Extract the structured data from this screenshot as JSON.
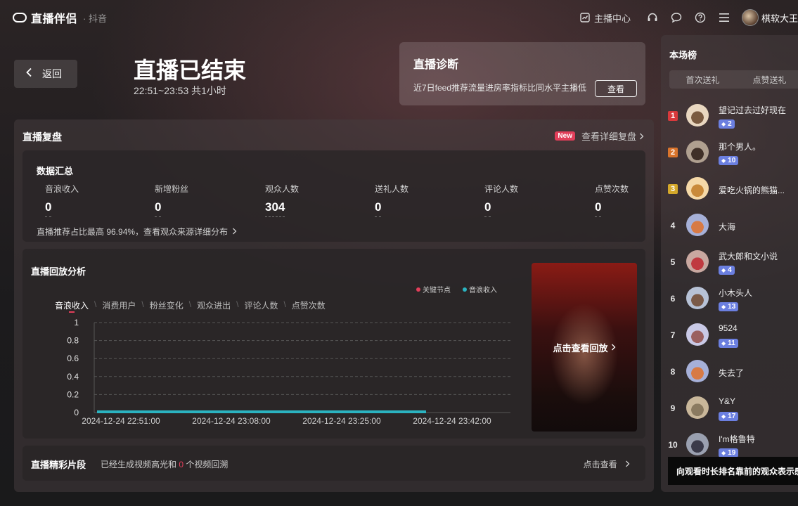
{
  "topbar": {
    "app_name": "直播伴侣",
    "app_sub": "· 抖音",
    "host_center_label": "主播中心",
    "user_name": "棋软大王"
  },
  "header": {
    "back_label": "返回",
    "title": "直播已结束",
    "time_range": "22:51~23:53 共1小时"
  },
  "diagnosis": {
    "title": "直播诊断",
    "desc": "近7日feed推荐流量进房率指标比同水平主播低",
    "button": "查看"
  },
  "review": {
    "title": "直播复盘",
    "badge": "New",
    "link": "查看详细复盘"
  },
  "summary": {
    "title": "数据汇总",
    "metrics": [
      {
        "label": "音浪收入",
        "value": "0"
      },
      {
        "label": "新增粉丝",
        "value": "0"
      },
      {
        "label": "观众人数",
        "value": "304"
      },
      {
        "label": "送礼人数",
        "value": "0"
      },
      {
        "label": "评论人数",
        "value": "0"
      },
      {
        "label": "点赞次数",
        "value": "0"
      }
    ],
    "footnote": "直播推荐占比最高 96.94%，查看观众来源详细分布"
  },
  "replay": {
    "title": "直播回放分析",
    "legend": [
      {
        "label": "关键节点",
        "color": "#e23e5a"
      },
      {
        "label": "音浪收入",
        "color": "#2bb3c0"
      }
    ],
    "tabs": [
      "音浪收入",
      "消费用户",
      "粉丝变化",
      "观众进出",
      "评论人数",
      "点赞次数"
    ],
    "video_label": "点击查看回放"
  },
  "chart_data": {
    "type": "area",
    "series": [
      {
        "name": "音浪收入",
        "values": [
          0,
          0,
          0,
          0
        ]
      }
    ],
    "x": [
      "2024-12-24 22:51:00",
      "2024-12-24 23:08:00",
      "2024-12-24 23:25:00",
      "2024-12-24 23:42:00"
    ],
    "y_ticks": [
      "1",
      "0.8",
      "0.6",
      "0.4",
      "0.2",
      "0"
    ],
    "ylim": [
      0,
      1
    ],
    "grid": true,
    "legend_position": "top-right"
  },
  "highlights": {
    "title": "直播精彩片段",
    "desc_pre": "已经生成视频高光和",
    "count": "0",
    "desc_post": "个视频回溯",
    "link": "点击查看"
  },
  "ranking": {
    "title": "本场榜",
    "tabs": [
      "首次送礼",
      "点赞送礼"
    ],
    "rows": [
      {
        "rank": "1",
        "name": "望记过去过好现在",
        "badge": "2"
      },
      {
        "rank": "2",
        "name": "那个男人。",
        "badge": "10"
      },
      {
        "rank": "3",
        "name": "爱吃火锅的熊猫...",
        "badge": ""
      },
      {
        "rank": "4",
        "name": "大海",
        "badge": ""
      },
      {
        "rank": "5",
        "name": "武大郎和文小说",
        "badge": "4"
      },
      {
        "rank": "6",
        "name": "小木头人",
        "badge": "13"
      },
      {
        "rank": "7",
        "name": "9524",
        "badge": "11"
      },
      {
        "rank": "8",
        "name": "失去了",
        "badge": ""
      },
      {
        "rank": "9",
        "name": "Y&Y",
        "badge": "17"
      },
      {
        "rank": "10",
        "name": "I'm格鲁特",
        "badge": "19"
      }
    ],
    "tooltip": "向观看时长排名靠前的观众表示感谢"
  },
  "colors": {
    "accent": "#e23e5a",
    "chart_line": "#2bb3c0",
    "rank1": "#d8393c",
    "rank2": "#d9742c",
    "rank3": "#d4a82a",
    "badge": "#6b7fe0"
  }
}
